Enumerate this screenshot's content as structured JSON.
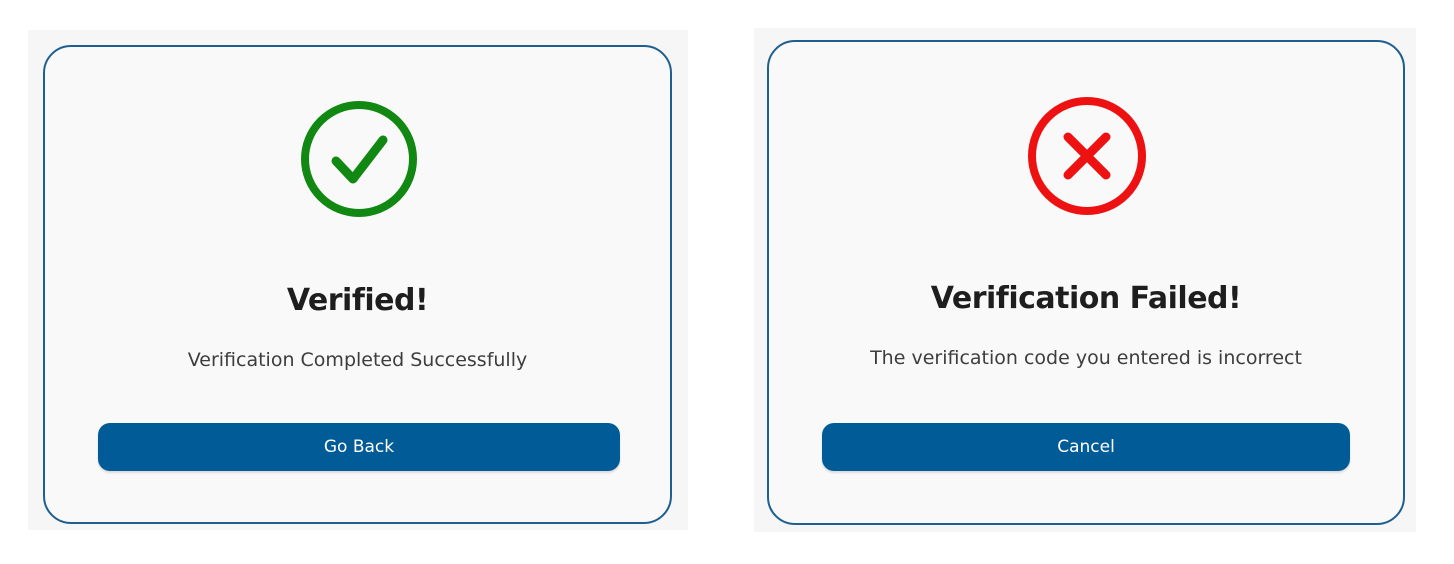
{
  "success_dialog": {
    "icon": "check-circle-icon",
    "icon_color": "#118811",
    "title": "Verified!",
    "message": "Verification Completed Successfully",
    "button_label": "Go Back"
  },
  "error_dialog": {
    "icon": "x-circle-icon",
    "icon_color": "#ee1111",
    "title": "Verification Failed!",
    "message": "The verification code you entered is incorrect",
    "button_label": "Cancel"
  },
  "colors": {
    "border": "#1f5f8f",
    "button": "#005b97",
    "card_background": "#f9f9f9"
  }
}
